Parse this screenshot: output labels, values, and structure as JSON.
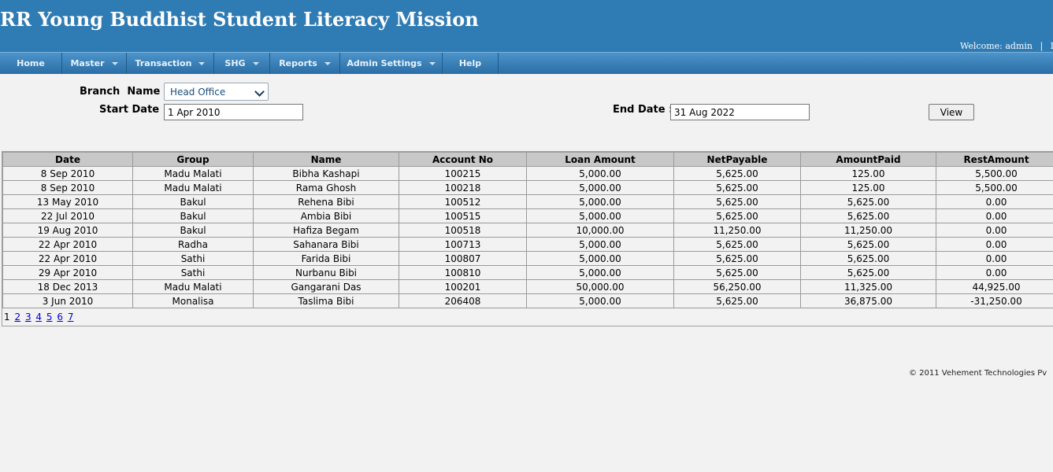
{
  "header": {
    "title": "RR Young Buddhist Student Literacy Mission",
    "welcome_label": "Welcome:",
    "user": "admin",
    "separator": "|",
    "logout": "Lo"
  },
  "nav": {
    "items": [
      {
        "label": "Home"
      },
      {
        "label": "Master"
      },
      {
        "label": "Transaction"
      },
      {
        "label": "SHG"
      },
      {
        "label": "Reports"
      },
      {
        "label": "Admin Settings"
      },
      {
        "label": "Help"
      }
    ]
  },
  "filters": {
    "branch_label": "Branch  Name :",
    "branch_value": "Head Office",
    "start_label": "Start Date :",
    "start_value": "1 Apr 2010",
    "end_label": "End Date :",
    "end_value": "31 Aug 2022",
    "view_label": "View"
  },
  "table": {
    "headers": [
      "Date",
      "Group",
      "Name",
      "Account No",
      "Loan Amount",
      "NetPayable",
      "AmountPaid",
      "RestAmount"
    ],
    "rows": [
      [
        "8 Sep 2010",
        "Madu Malati",
        "Bibha Kashapi",
        "100215",
        "5,000.00",
        "5,625.00",
        "125.00",
        "5,500.00"
      ],
      [
        "8 Sep 2010",
        "Madu Malati",
        "Rama Ghosh",
        "100218",
        "5,000.00",
        "5,625.00",
        "125.00",
        "5,500.00"
      ],
      [
        "13 May 2010",
        "Bakul",
        "Rehena Bibi",
        "100512",
        "5,000.00",
        "5,625.00",
        "5,625.00",
        "0.00"
      ],
      [
        "22 Jul 2010",
        "Bakul",
        "Ambia Bibi",
        "100515",
        "5,000.00",
        "5,625.00",
        "5,625.00",
        "0.00"
      ],
      [
        "19 Aug 2010",
        "Bakul",
        "Hafiza Begam",
        "100518",
        "10,000.00",
        "11,250.00",
        "11,250.00",
        "0.00"
      ],
      [
        "22 Apr 2010",
        "Radha",
        "Sahanara Bibi",
        "100713",
        "5,000.00",
        "5,625.00",
        "5,625.00",
        "0.00"
      ],
      [
        "22 Apr 2010",
        "Sathi",
        "Farida Bibi",
        "100807",
        "5,000.00",
        "5,625.00",
        "5,625.00",
        "0.00"
      ],
      [
        "29 Apr 2010",
        "Sathi",
        "Nurbanu Bibi",
        "100810",
        "5,000.00",
        "5,625.00",
        "5,625.00",
        "0.00"
      ],
      [
        "18 Dec 2013",
        "Madu Malati",
        "Gangarani Das",
        "100201",
        "50,000.00",
        "56,250.00",
        "11,325.00",
        "44,925.00"
      ],
      [
        "3 Jun 2010",
        "Monalisa",
        "Taslima Bibi",
        "206408",
        "5,000.00",
        "5,625.00",
        "36,875.00",
        "-31,250.00"
      ]
    ]
  },
  "pager": {
    "current": "1",
    "links": [
      "2",
      "3",
      "4",
      "5",
      "6",
      "7"
    ]
  },
  "footer": {
    "text": "© 2011 Vehement Technologies Pv"
  },
  "colors": {
    "header_bg": "#2f7bb3",
    "nav_bg": "#3a84bd",
    "table_header_bg": "#c8c8c8",
    "page_bg": "#f2f2f2"
  }
}
